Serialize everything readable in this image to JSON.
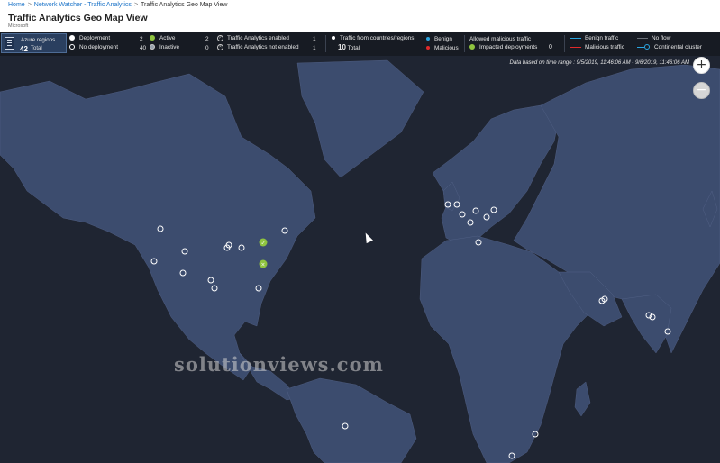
{
  "breadcrumb": {
    "home": "Home",
    "parent": "Network Watcher - Traffic Analytics",
    "current": "Traffic Analytics Geo Map View"
  },
  "page": {
    "title": "Traffic Analytics Geo Map View",
    "subtitle": "Microsoft"
  },
  "legend": {
    "azure_regions_label": "Azure regions",
    "azure_regions_count": "42",
    "azure_regions_total": "Total",
    "deployment_label": "Deployment",
    "deployment_count": "2",
    "no_deployment_label": "No deployment",
    "no_deployment_count": "40",
    "active_label": "Active",
    "active_count": "2",
    "inactive_label": "Inactive",
    "inactive_count": "0",
    "ta_enabled_label": "Traffic Analytics enabled",
    "ta_enabled_count": "1",
    "ta_not_enabled_label": "Traffic Analytics not enabled",
    "ta_not_enabled_count": "1",
    "traffic_from_label": "Traffic from countries/regions",
    "traffic_from_count": "10",
    "traffic_from_total": "Total",
    "benign_label": "Benign",
    "malicious_label": "Malicious",
    "allowed_malicious_label": "Allowed malicious traffic",
    "impacted_label": "Impacted deployments",
    "impacted_count": "0",
    "benign_traffic_label": "Benign traffic",
    "malicious_traffic_label": "Malicious traffic",
    "no_flow_label": "No flow",
    "continental_cluster_label": "Continental cluster"
  },
  "map": {
    "time_range": "Data based on time range : 9/5/2019, 11:46:06 AM - 9/6/2019, 11:46:06 AM",
    "zoom_in": "+",
    "zoom_out": "−",
    "watermark": "solutionviews.com"
  },
  "colors": {
    "background": "#1f2532",
    "land": "#3c4c6e",
    "active": "#8fc43f",
    "benign": "#2aa5e0",
    "malicious": "#e02a2a"
  }
}
